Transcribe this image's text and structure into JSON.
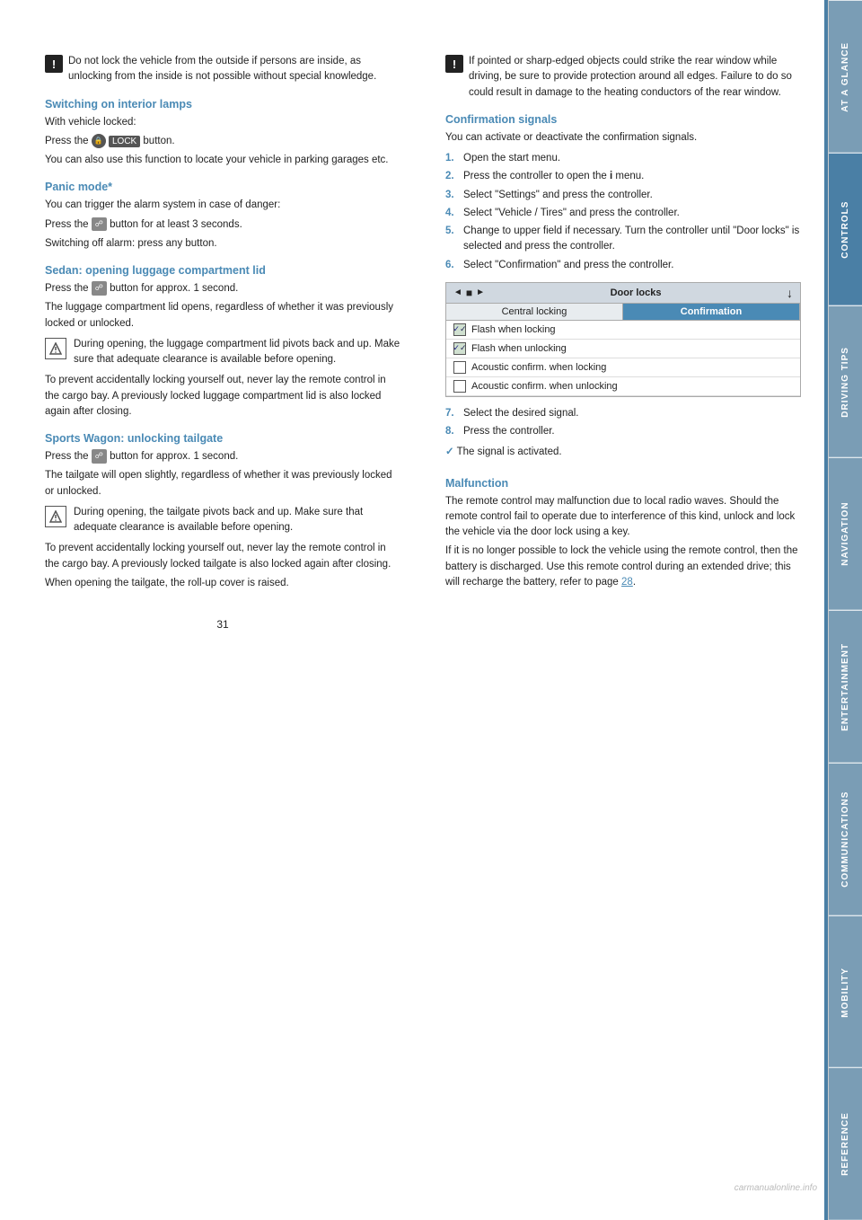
{
  "page": {
    "number": "31",
    "watermark": "carmanualonline.info"
  },
  "sidebar": {
    "tabs": [
      {
        "label": "At a glance",
        "class": "at-glance"
      },
      {
        "label": "Controls",
        "class": "controls",
        "active": true
      },
      {
        "label": "Driving tips",
        "class": "driving"
      },
      {
        "label": "Navigation",
        "class": "navigation"
      },
      {
        "label": "Entertainment",
        "class": "entertainment"
      },
      {
        "label": "Communications",
        "class": "communications"
      },
      {
        "label": "Mobility",
        "class": "mobility"
      },
      {
        "label": "Reference",
        "class": "reference"
      }
    ]
  },
  "left_col": {
    "warning1": {
      "text": "Do not lock the vehicle from the outside if persons are inside, as unlocking from the inside is not possible without special knowledge."
    },
    "section1": {
      "heading": "Switching on interior lamps",
      "content": [
        "With vehicle locked:",
        "Press the LOCK button.",
        "You can also use this function to locate your vehicle in parking garages etc."
      ]
    },
    "section2": {
      "heading": "Panic mode*",
      "content": [
        "You can trigger the alarm system in case of danger:",
        "Press the button for at least 3 seconds.",
        "Switching off alarm: press any button."
      ]
    },
    "section3": {
      "heading": "Sedan: opening luggage compartment lid",
      "para1": "Press the button for approx. 1 second.",
      "para2": "The luggage compartment lid opens, regardless of whether it was previously locked or unlocked.",
      "note1": "During opening, the luggage compartment lid pivots back and up. Make sure that adequate clearance is available before opening.",
      "para3": "To prevent accidentally locking yourself out, never lay the remote control in the cargo bay. A previously locked luggage compartment lid is also locked again after closing."
    },
    "section4": {
      "heading": "Sports Wagon: unlocking tailgate",
      "para1": "Press the button for approx. 1 second.",
      "para2": "The tailgate will open slightly, regardless of whether it was previously locked or unlocked.",
      "note1": "During opening, the tailgate pivots back and up. Make sure that adequate clearance is available before opening.",
      "para3": "To prevent accidentally locking yourself out, never lay the remote control in the cargo bay. A previously locked tailgate is also locked again after closing.",
      "para4": "When opening the tailgate, the roll-up cover is raised."
    }
  },
  "right_col": {
    "warning1": {
      "text": "If pointed or sharp-edged objects could strike the rear window while driving, be sure to provide protection around all edges. Failure to do so could result in damage to the heating conductors of the rear window."
    },
    "section1": {
      "heading": "Confirmation signals",
      "intro": "You can activate or deactivate the confirmation signals.",
      "steps": [
        "Open the start menu.",
        "Press the controller to open the i menu.",
        "Select \"Settings\" and press the controller.",
        "Select \"Vehicle / Tires\" and press the controller.",
        "Change to upper field if necessary. Turn the controller until \"Door locks\" is selected and press the controller.",
        "Select \"Confirmation\" and press the controller."
      ],
      "ui": {
        "header": "Door locks",
        "tab1": "Central locking",
        "tab2": "Confirmation",
        "rows": [
          {
            "label": "Flash when locking",
            "checked": true
          },
          {
            "label": "Flash when unlocking",
            "checked": true
          },
          {
            "label": "Acoustic confirm. when locking",
            "checked": false
          },
          {
            "label": "Acoustic confirm. when unlocking",
            "checked": false
          }
        ]
      },
      "steps2": [
        "Select the desired signal.",
        "Press the controller."
      ],
      "result": "The signal is activated."
    },
    "section2": {
      "heading": "Malfunction",
      "para1": "The remote control may malfunction due to local radio waves. Should the remote control fail to operate due to interference of this kind, unlock and lock the vehicle via the door lock using a key.",
      "para2": "If it is no longer possible to lock the vehicle using the remote control, then the battery is discharged. Use this remote control during an extended drive; this will recharge the battery, refer to page 28."
    }
  }
}
